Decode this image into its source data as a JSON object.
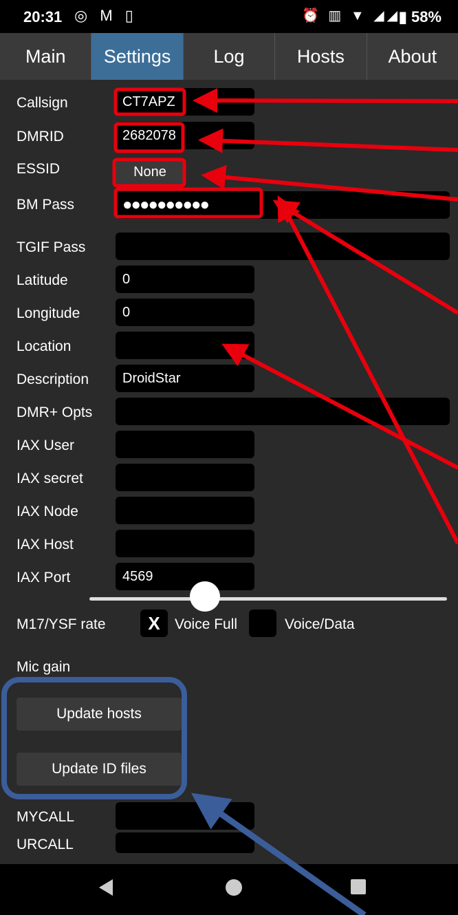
{
  "status_bar": {
    "time": "20:31",
    "left_icons": [
      "whatsapp-icon",
      "gmail-icon",
      "sim-icon"
    ],
    "right_icons": [
      "alarm-icon",
      "vibrate-icon",
      "wifi-icon",
      "signal-icon",
      "signal-icon"
    ],
    "battery": "58%"
  },
  "tabs": [
    {
      "label": "Main",
      "active": false
    },
    {
      "label": "Settings",
      "active": true
    },
    {
      "label": "Log",
      "active": false
    },
    {
      "label": "Hosts",
      "active": false
    },
    {
      "label": "About",
      "active": false
    }
  ],
  "settings": {
    "callsign": {
      "label": "Callsign",
      "value": "CT7APZ"
    },
    "dmrid": {
      "label": "DMRID",
      "value": "2682078"
    },
    "essid": {
      "label": "ESSID",
      "value": "None"
    },
    "bm_pass": {
      "label": "BM Pass",
      "value": "●●●●●●●●●●"
    },
    "tgif_pass": {
      "label": "TGIF Pass",
      "value": ""
    },
    "latitude": {
      "label": "Latitude",
      "value": "0"
    },
    "longitude": {
      "label": "Longitude",
      "value": "0"
    },
    "location": {
      "label": "Location",
      "value": ""
    },
    "description": {
      "label": "Description",
      "value": "DroidStar"
    },
    "dmr_opts": {
      "label": "DMR+ Opts",
      "value": ""
    },
    "iax_user": {
      "label": "IAX User",
      "value": ""
    },
    "iax_secret": {
      "label": "IAX secret",
      "value": ""
    },
    "iax_node": {
      "label": "IAX Node",
      "value": ""
    },
    "iax_host": {
      "label": "IAX Host",
      "value": ""
    },
    "iax_port": {
      "label": "IAX Port",
      "value": "4569"
    },
    "rate": {
      "label": "M17/YSF rate",
      "voice_full": {
        "label": "Voice Full",
        "checked": true,
        "mark": "X"
      },
      "voice_data": {
        "label": "Voice/Data",
        "checked": false
      }
    },
    "mic_gain": {
      "label": "Mic gain",
      "value_fraction": 0.33
    },
    "update_hosts_label": "Update hosts",
    "update_id_files_label": "Update ID files",
    "mycall": {
      "label": "MYCALL",
      "value": ""
    },
    "urcall": {
      "label": "URCALL",
      "value": ""
    }
  },
  "annotations": {
    "red": "#e8000d",
    "blue": "#3b5d9a"
  }
}
